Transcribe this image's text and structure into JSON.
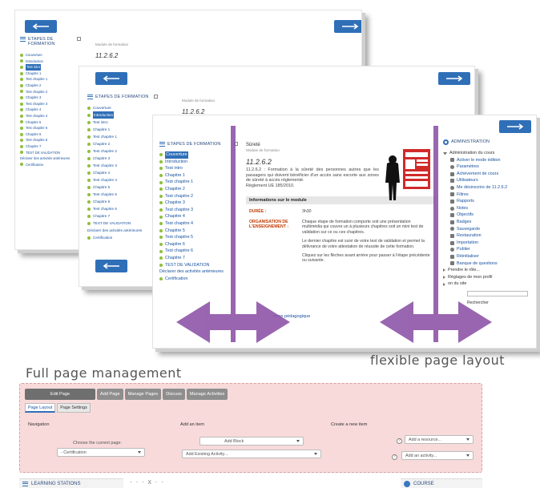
{
  "card1": {
    "block_title": "ETAPES DE FORMATION",
    "toc": [
      "Couverture",
      "Introduction",
      "Test intro",
      "Chapitre 1",
      "Test chapitre 1",
      "Chapitre 2",
      "Test chapitre 2",
      "Chapitre 3",
      "Test chapitre 3",
      "Chapitre 4",
      "Test chapitre 4",
      "Chapitre 5",
      "Test chapitre 5",
      "Chapitre 6",
      "Test chapitre 6",
      "Chapitre 7",
      "TEST DE VALIDATION"
    ],
    "highlighted_index": 2,
    "declarer": "Déclarer des activités antérieures",
    "certification": "Certification",
    "module_label": "Module de formation",
    "module_code": "11.2.6.2"
  },
  "card2": {
    "block_title": "ETAPES DE FORMATION",
    "toc": [
      "Couverture",
      "Introduction",
      "Test intro",
      "Chapitre 1",
      "Test chapitre 1",
      "Chapitre 2",
      "Test chapitre 2",
      "Chapitre 3",
      "Test chapitre 3",
      "Chapitre 4",
      "Test chapitre 4",
      "Chapitre 5",
      "Test chapitre 5",
      "Chapitre 6",
      "Test chapitre 6",
      "Chapitre 7",
      "TEST DE VALIDATION"
    ],
    "highlighted_index": 1,
    "declarer": "Déclarer des activités antérieures",
    "certification": "Certification",
    "module_label": "Module de formation",
    "module_code": "11.2.6.2"
  },
  "card3": {
    "block_title": "ETAPES DE FORMATION",
    "toc": [
      "Couverture",
      "Introduction",
      "Test intro",
      "Chapitre 1",
      "Test chapitre 1",
      "Chapitre 2",
      "Test chapitre 2",
      "Chapitre 3",
      "Test chapitre 3",
      "Chapitre 4",
      "Test chapitre 4",
      "Chapitre 5",
      "Test chapitre 5",
      "Chapitre 6",
      "Test chapitre 6",
      "Chapitre 7",
      "TEST DE VALIDATION"
    ],
    "highlighted_index": 0,
    "declarer": "Déclarer des activités antérieures",
    "certification": "Certification",
    "title": "Sûreté",
    "module_label": "Module de formation",
    "module_code": "11.2.6.2",
    "description": "11.2.6.2 : Formation à la sûreté des personnes autres que les passagers qui doivent bénéficier d'un accès sans escorte aux zones de sûreté à accès réglementé.",
    "regulation": "Règlement UE 185/2010.",
    "info_header": "Informations sur le module",
    "duree_label": "DURÉE :",
    "duree_value": "3h30",
    "org_label": "ORGANISATION DE L'ENSEIGNEMENT :",
    "org_p1": "Chaque étape de formation comporte soit une présentation multimédia qui couvre un à plusieurs chapitres soit un mini test de validation sur ce ou ces chapitres.",
    "org_p2": "Le dernier chapitre est suivi de votre test de validation et permet la délivrance de votre attestation de réussite de cette formation.",
    "org_p3": "Cliquez sur les flèches avant arrière pour passer à l'étape précédente ou suivante.",
    "link_fragment": "mme pédagogique",
    "admin_title": "ADMINISTRATION",
    "admin_course": "Administration du cours",
    "admin_items": [
      "Activer le mode édition",
      "Paramètres",
      "Achèvement de cours",
      "Utilisateurs",
      "Me désinscrire de 11.2.6.2",
      "Filtres",
      "Rapports",
      "Notes",
      "Objectifs",
      "Badges",
      "Sauvegarde",
      "Restauration",
      "Importation",
      "Publier",
      "Réinitialiser",
      "Banque de questions"
    ],
    "role_label": "Prendre le rôle...",
    "profile_label": "Réglages de mon profil",
    "site_label": "on du site",
    "search_button": "Rechercher"
  },
  "captions": {
    "flexible": "flexible page layout",
    "full": "Full page management"
  },
  "pm": {
    "top_tabs": [
      "Edit Page",
      "Add Page",
      "Manage Pages",
      "Discuss",
      "Manage Activities"
    ],
    "sub_tabs": [
      "Page Layout",
      "Page Settings"
    ],
    "nav_head": "Navigation",
    "add_item_head": "Add an item",
    "create_head": "Create a new item",
    "choose_label": "Choose the current page:",
    "current_page": "- Certification",
    "add_block": "Add Block",
    "add_existing": "Add Existing Activity...",
    "add_resource": "Add a resource...",
    "add_activity": "Add an activity...",
    "help_glyph": "?",
    "foot_left": "LEARNING STATIONS",
    "foot_right": "COURSE",
    "foot_dots": "· · · x · ·"
  },
  "colors": {
    "nav_button": "#2f6fb7",
    "arrow_purple": "#8e55a8",
    "pm_background": "#f8dada"
  }
}
